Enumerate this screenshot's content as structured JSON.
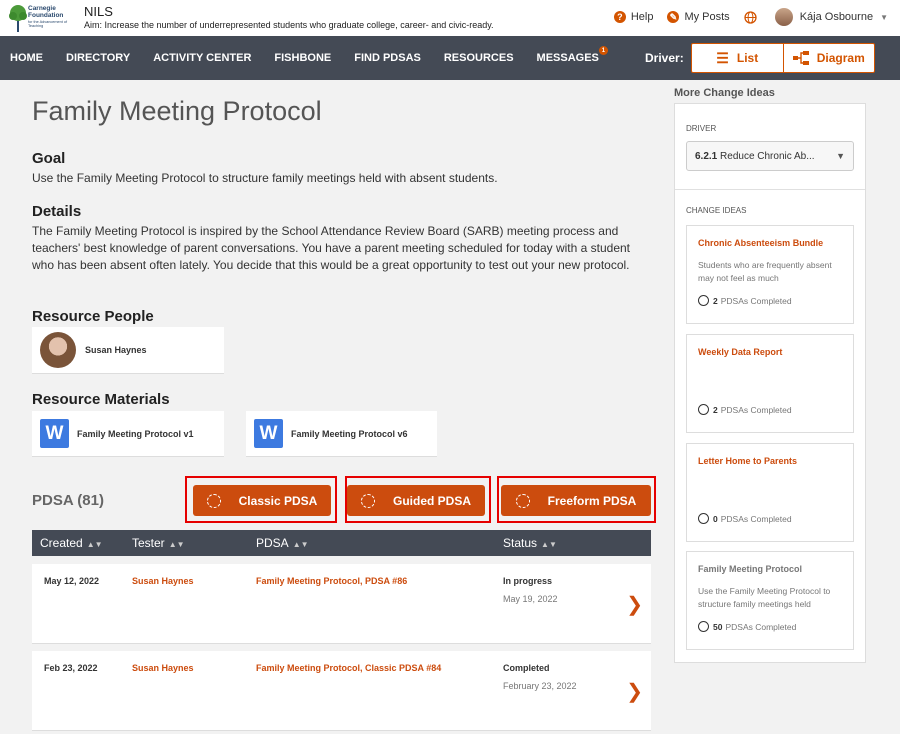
{
  "header": {
    "logo_title": "Carnegie Foundation",
    "logo_subtitle": "for the Advancement of Teaching",
    "app_name": "NILS",
    "aim": "Aim: Increase the number of underrepresented students who graduate college, career- and civic-ready.",
    "help": "Help",
    "my_posts": "My Posts",
    "user_name": "Kája Osbourne"
  },
  "nav": {
    "items": [
      "HOME",
      "DIRECTORY",
      "ACTIVITY CENTER",
      "FISHBONE",
      "FIND PDSAS",
      "RESOURCES",
      "MESSAGES"
    ],
    "messages_badge": "1",
    "driver_label": "Driver:",
    "list_label": "List",
    "diagram_label": "Diagram"
  },
  "main": {
    "title": "Family Meeting Protocol",
    "goal_heading": "Goal",
    "goal_text": "Use the Family Meeting Protocol to structure family meetings held with absent students.",
    "details_heading": "Details",
    "details_text": "The Family Meeting Protocol is inspired by the School Attendance Review Board (SARB) meeting process and teachers' best knowledge of parent conversations. You have a parent meeting scheduled for today with a student who has been absent often lately. You decide that this would be a great opportunity to test out your new protocol.",
    "people_heading": "Resource People",
    "person_name": "Susan Haynes",
    "materials_heading": "Resource Materials",
    "materials": [
      "Family Meeting Protocol v1",
      "Family Meeting Protocol v6"
    ],
    "word_letter": "W",
    "pdsa_count": "PDSA (81)",
    "buttons": {
      "classic": "Classic PDSA",
      "guided": "Guided PDSA",
      "freeform": "Freeform PDSA"
    },
    "table": {
      "headers": [
        "Created",
        "Tester",
        "PDSA",
        "Status"
      ],
      "rows": [
        {
          "created": "May 12, 2022",
          "tester": "Susan Haynes",
          "pdsa": "Family Meeting Protocol, PDSA #86",
          "status": "In progress",
          "status_date": "May 19, 2022"
        },
        {
          "created": "Feb 23, 2022",
          "tester": "Susan Haynes",
          "pdsa": "Family Meeting Protocol, Classic PDSA #84",
          "status": "Completed",
          "status_date": "February 23, 2022"
        }
      ]
    }
  },
  "sidebar": {
    "title": "More Change Ideas",
    "driver_label": "DRIVER",
    "driver_value": "6.2.1 Reduce Chronic Ab...",
    "driver_number": "6.2.1",
    "driver_text": "Reduce Chronic Ab...",
    "change_ideas_label": "CHANGE IDEAS",
    "pdsas_completed_label": "PDSAs Completed",
    "ideas": [
      {
        "title": "Chronic Absenteeism Bundle",
        "desc": "Students who are frequently absent may not feel as much",
        "count": "2"
      },
      {
        "title": "Weekly Data Report",
        "desc": "",
        "count": "2"
      },
      {
        "title": "Letter Home to Parents",
        "desc": "",
        "count": "0"
      },
      {
        "title": "Family Meeting Protocol",
        "desc": "Use the Family Meeting Protocol to structure family meetings held",
        "count": "50"
      }
    ]
  },
  "colors": {
    "accent": "#cc4c0e",
    "nav_bg": "#444a55",
    "highlight": "#e60000"
  }
}
